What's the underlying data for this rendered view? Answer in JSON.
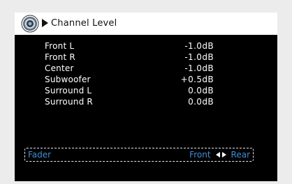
{
  "header": {
    "icon": "speaker-icon",
    "arrow_icon": "play-arrow-icon",
    "title": "Channel Level"
  },
  "channels": [
    {
      "name": "Front L",
      "value": "-1.0dB"
    },
    {
      "name": "Front R",
      "value": "-1.0dB"
    },
    {
      "name": "Center",
      "value": "-1.0dB"
    },
    {
      "name": "Subwoofer",
      "value": "+0.5dB"
    },
    {
      "name": "Surround L",
      "value": "0.0dB"
    },
    {
      "name": "Surround R",
      "value": "0.0dB"
    }
  ],
  "fader": {
    "label": "Fader",
    "left_option": "Front",
    "right_option": "Rear",
    "left_icon": "left-arrow-icon",
    "right_icon": "right-arrow-icon"
  },
  "colors": {
    "screen_bg": "#000000",
    "header_bg": "#ffffff",
    "highlight": "#3f8fd8",
    "page_bg": "#ececec"
  }
}
